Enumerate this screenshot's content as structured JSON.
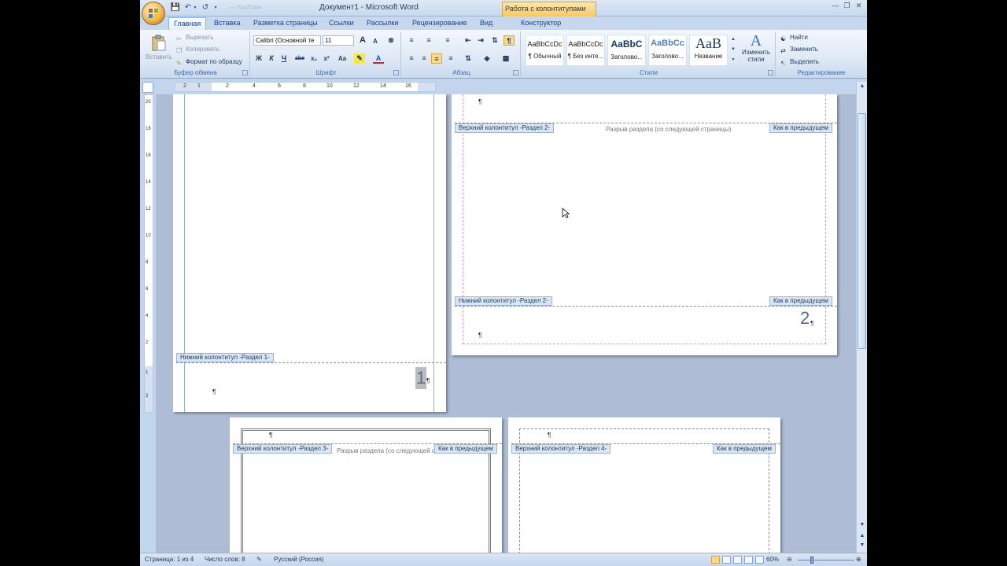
{
  "window": {
    "title": "Документ1 - Microsoft Word",
    "context_tab_title": "Работа с колонтитулами",
    "qat_faded": "...  — YouTube"
  },
  "tabs": [
    {
      "label": "Главная",
      "active": true
    },
    {
      "label": "Вставка"
    },
    {
      "label": "Разметка страницы"
    },
    {
      "label": "Ссылки"
    },
    {
      "label": "Рассылки"
    },
    {
      "label": "Рецензирование"
    },
    {
      "label": "Вид"
    },
    {
      "label": "Конструктор"
    }
  ],
  "ribbon": {
    "clipboard": {
      "label": "Буфер обмена",
      "paste": "Вставить",
      "cut": "Вырезать",
      "copy": "Копировать",
      "format_painter": "Формат по образцу"
    },
    "font": {
      "label": "Шрифт",
      "font_name": "Calibri (Основной те",
      "font_size": "11",
      "bold": "Ж",
      "italic": "К",
      "underline": "Ч",
      "strike": "abe",
      "subscript": "x₂",
      "superscript": "x²",
      "case": "Aa",
      "grow": "A",
      "shrink": "A"
    },
    "paragraph": {
      "label": "Абзац"
    },
    "styles": {
      "label": "Стили",
      "items": [
        {
          "sample": "AaBbCcDc",
          "name": "¶ Обычный"
        },
        {
          "sample": "AaBbCcDc",
          "name": "¶ Без инте..."
        },
        {
          "sample": "AaBbC",
          "name": "Заголово..."
        },
        {
          "sample": "AaBbCc",
          "name": "Заголово..."
        },
        {
          "sample": "AaB",
          "name": "Название"
        }
      ],
      "change_styles": "Изменить",
      "change_styles_2": "стили"
    },
    "editing": {
      "label": "Редактирование",
      "find": "Найти",
      "replace": "Заменить",
      "select": "Выделить"
    }
  },
  "ruler": {
    "h_ticks": [
      "2",
      "1",
      "2",
      "4",
      "6",
      "8",
      "10",
      "12",
      "14",
      "16"
    ],
    "v_ticks": [
      "20",
      "18",
      "16",
      "14",
      "12",
      "10",
      "8",
      "6",
      "4",
      "2",
      "1",
      "2"
    ]
  },
  "pages": {
    "p1": {
      "footer_tag": "Нижний колонтитул -Раздел 1-",
      "page_number": "1"
    },
    "p2": {
      "header_tag": "Верхний колонтитул -Раздел 2-",
      "break_text": "Разрыв раздела (со следующей страницы)",
      "same_as_prev": "Как в предыдущем",
      "footer_tag": "Нижний колонтитул -Раздел 2-",
      "footer_same": "Как в предыдущем",
      "page_number": "2"
    },
    "p3": {
      "header_tag": "Верхний колонтитул -Раздел 3-",
      "break_text": "Разрыв раздела (со следующей с",
      "same_as_prev": "Как в предыдущем"
    },
    "p4": {
      "header_tag": "Верхний колонтитул -Раздел 4-",
      "same_as_prev": "Как в предыдущем"
    },
    "pilcrow": "¶"
  },
  "statusbar": {
    "page": "Страница: 1 из 4",
    "words": "Число слов: 8",
    "language": "Русский (Россия)",
    "zoom": "60%"
  }
}
